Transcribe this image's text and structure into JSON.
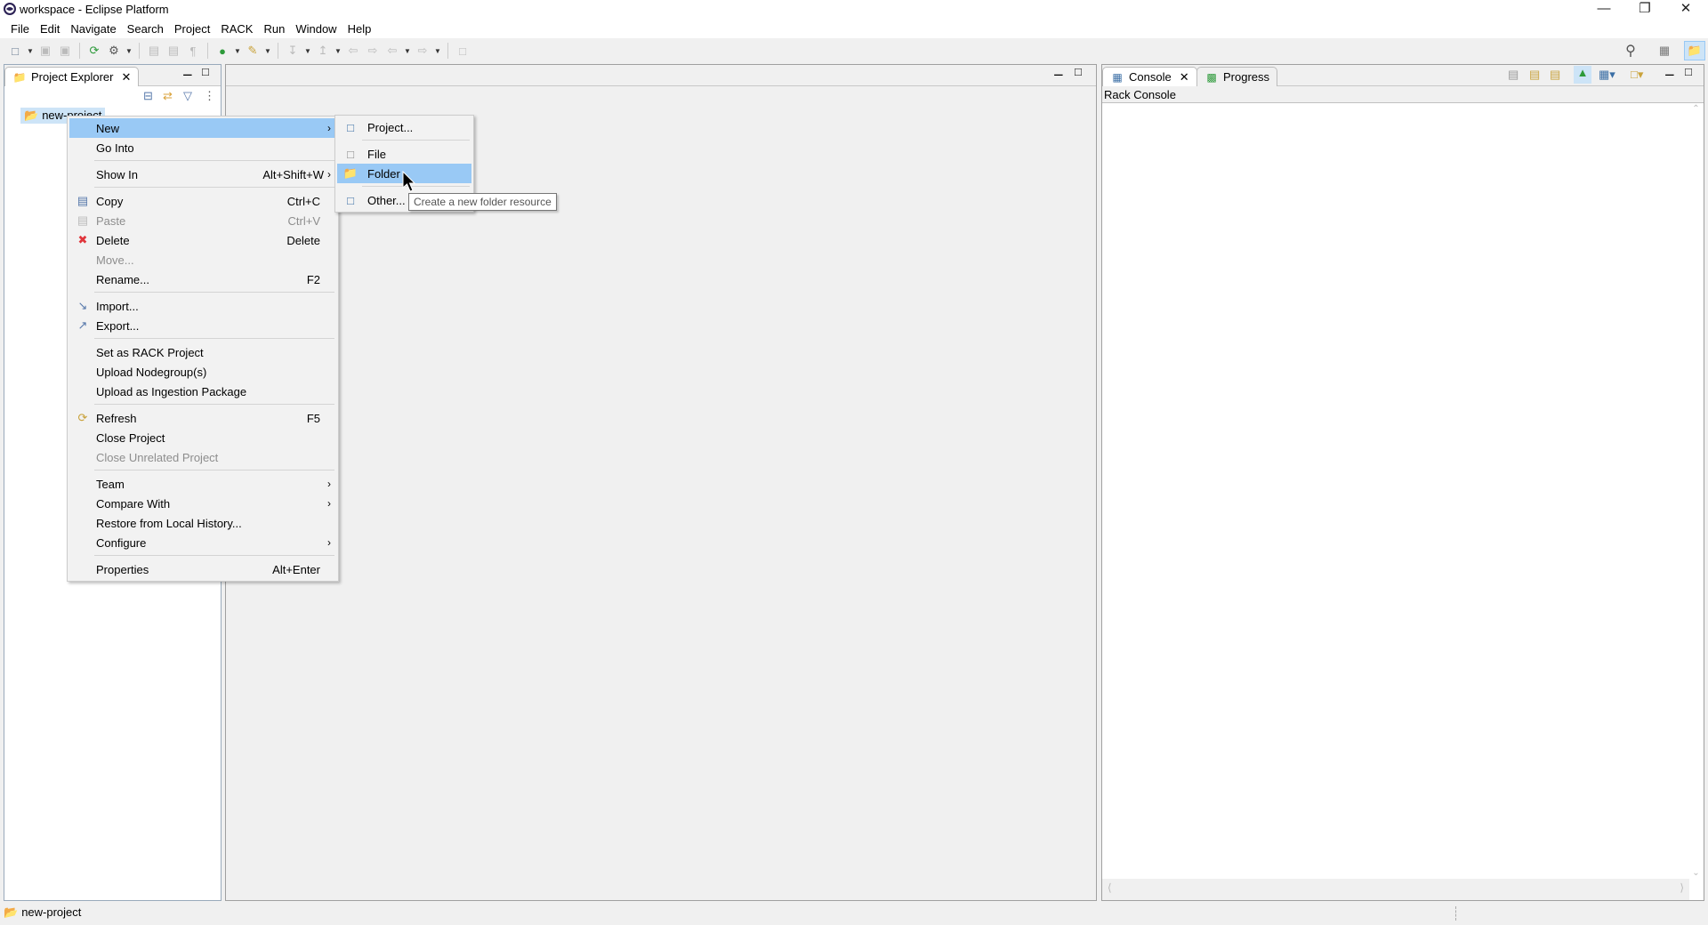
{
  "window": {
    "title": "workspace - Eclipse Platform",
    "icon": "eclipse-icon",
    "controls": [
      "minimize",
      "restore",
      "close"
    ]
  },
  "menubar": [
    "File",
    "Edit",
    "Navigate",
    "Search",
    "Project",
    "RACK",
    "Run",
    "Window",
    "Help"
  ],
  "project_explorer": {
    "tab_label": "Project Explorer",
    "tree": [
      {
        "label": "new-project",
        "icon": "project-folder-icon"
      }
    ]
  },
  "console": {
    "tabs": [
      {
        "label": "Console",
        "active": true
      },
      {
        "label": "Progress",
        "active": false
      }
    ],
    "title": "Rack Console"
  },
  "status_bar": {
    "text": "new-project"
  },
  "context_menu": {
    "groups": [
      [
        {
          "label": "New",
          "submenu": true,
          "highlighted": true
        },
        {
          "label": "Go Into"
        }
      ],
      [
        {
          "label": "Show In",
          "shortcut": "Alt+Shift+W",
          "submenu": true
        }
      ],
      [
        {
          "label": "Copy",
          "shortcut": "Ctrl+C",
          "icon": "copy-icon"
        },
        {
          "label": "Paste",
          "shortcut": "Ctrl+V",
          "icon": "paste-icon",
          "disabled": true
        },
        {
          "label": "Delete",
          "shortcut": "Delete",
          "icon": "delete-icon"
        },
        {
          "label": "Move...",
          "disabled": true
        },
        {
          "label": "Rename...",
          "shortcut": "F2"
        }
      ],
      [
        {
          "label": "Import...",
          "icon": "import-icon"
        },
        {
          "label": "Export...",
          "icon": "export-icon"
        }
      ],
      [
        {
          "label": "Set as RACK Project"
        },
        {
          "label": "Upload Nodegroup(s)"
        },
        {
          "label": "Upload as Ingestion Package"
        }
      ],
      [
        {
          "label": "Refresh",
          "shortcut": "F5",
          "icon": "refresh-icon"
        },
        {
          "label": "Close Project"
        },
        {
          "label": "Close Unrelated Project",
          "disabled": true
        }
      ],
      [
        {
          "label": "Team",
          "submenu": true
        },
        {
          "label": "Compare With",
          "submenu": true
        },
        {
          "label": "Restore from Local History..."
        },
        {
          "label": "Configure",
          "submenu": true
        }
      ],
      [
        {
          "label": "Properties",
          "shortcut": "Alt+Enter"
        }
      ]
    ]
  },
  "new_submenu": {
    "groups": [
      [
        {
          "label": "Project...",
          "icon": "new-project-icon"
        }
      ],
      [
        {
          "label": "File",
          "icon": "new-file-icon"
        },
        {
          "label": "Folder",
          "icon": "new-folder-icon",
          "highlighted": true
        }
      ],
      [
        {
          "label": "Other...",
          "icon": "new-other-icon"
        }
      ]
    ]
  },
  "tooltip": "Create a new folder resource",
  "colors": {
    "highlight": "#99c9f5",
    "menu_bg": "#f2f2f2",
    "disabled": "#8d8d8d"
  }
}
